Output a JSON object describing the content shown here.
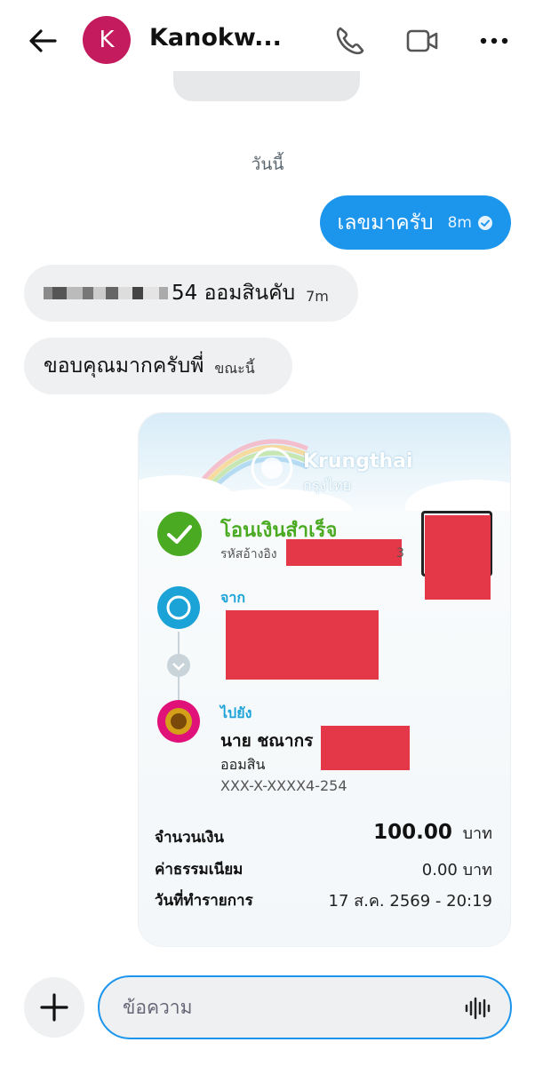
{
  "header": {
    "avatar_letter": "K",
    "contact_name": "Kanokw...",
    "icons": [
      "back-arrow-icon",
      "phone-icon",
      "video-icon",
      "more-icon"
    ]
  },
  "messages": {
    "date_separator": "วันนี้",
    "outgoing": {
      "text": "เลขมาครับ",
      "time": "8m"
    },
    "incoming1": {
      "text": "54 ออมสินคับ",
      "time": "7m"
    },
    "incoming2": {
      "text": "ขอบคุณมากครับพี่",
      "time": "ขณะนี้"
    }
  },
  "slip": {
    "bank_name_en": "Krungthai",
    "bank_name_th": "กรุงไทย",
    "status": "โอนเงินสำเร็จ",
    "ref_label": "รหัสอ้างอิง",
    "ref_tail": "3",
    "from_label": "จาก",
    "to_label": "ไปยัง",
    "to_name": "นาย ชณากร",
    "to_bank": "ออมสิน",
    "to_account": "XXX-X-XXXX4-254",
    "amount_label": "จำนวนเงิน",
    "amount_value": "100.00",
    "amount_unit": "บาท",
    "fee_label": "ค่าธรรมเนียม",
    "fee_value": "0.00 บาท",
    "date_label": "วันที่ทำรายการ",
    "date_value": "17 ส.ค. 2569 - 20:19",
    "colors": {
      "success": "#4aaa22",
      "accent": "#1ba3d8",
      "redaction": "#e43849"
    }
  },
  "composer": {
    "placeholder": "ข้อความ",
    "icons": [
      "plus-icon",
      "voice-wave-icon"
    ]
  },
  "colors": {
    "primary": "#1c95ed",
    "avatar": "#c41a5e",
    "bubble_in": "#eef0f1"
  }
}
